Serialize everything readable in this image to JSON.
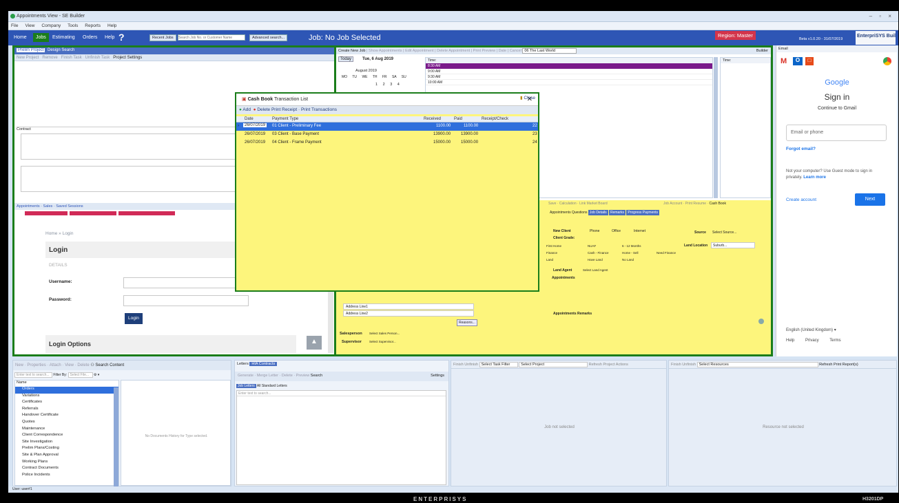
{
  "window": {
    "title": "Appointments View - SE Builder",
    "controls": "– ▫ ×"
  },
  "menu": [
    "File",
    "View",
    "Company",
    "Tools",
    "Reports",
    "Help"
  ],
  "nav": {
    "tabs": [
      "Home",
      "Jobs",
      "Estimating",
      "Orders",
      "Help"
    ],
    "help_icon": "?",
    "recent_jobs": "Recent Jobs",
    "search_placeholder": "Search Job No. or Customer Name",
    "advanced_search": "Advanced search...",
    "job_title": "Job: No Job Selected",
    "region": "Region: Master",
    "version": "Beta v1.0.20 - 31/07/2019",
    "logo": "EnterpriSYS Builder"
  },
  "left_top": {
    "tabs": [
      "Prelim Project",
      "Design Search"
    ],
    "toolbar": [
      "New Project",
      "Remove",
      "Finish Task",
      "Unfinish Task",
      "Project Settings"
    ],
    "contract_label": "Contract"
  },
  "calendar": {
    "tabs": [
      "Create New Job",
      "Show Appointments",
      "Edit Appointment",
      "Delete Appointment",
      "Print Preview",
      "Date",
      "Cancel",
      "06 The Last World",
      "Builder"
    ],
    "today": "Today",
    "date": "Tue, 6 Aug 2019",
    "month": "August 2019",
    "weekdays": [
      "MO",
      "TU",
      "WE",
      "TH",
      "FR",
      "SA",
      "SU"
    ],
    "days": [
      "1",
      "2",
      "3",
      "4"
    ],
    "time_header": "Time:",
    "times": [
      "8:30 AM",
      "9:00 AM",
      "9:30 AM",
      "10:00 AM"
    ]
  },
  "appointments": {
    "tabs": [
      "Appointments",
      "Sales",
      "Saved Sessions"
    ],
    "breadcrumb": [
      "Home",
      "Login"
    ],
    "login_title": "Login",
    "details": "DETAILS",
    "username_label": "Username:",
    "password_label": "Password:",
    "login_button": "Login",
    "login_options": "Login Options"
  },
  "dialog": {
    "title_bold": "Cash Book",
    "title_rest": "Transaction List",
    "close": "✕",
    "toolbar": {
      "add": "Add",
      "delete": "Delete",
      "print_receipt": "Print Receipt",
      "print_transactions": "Print Transactions",
      "close": "Close"
    },
    "columns": [
      "Date",
      "Payment Type",
      "Received",
      "Paid",
      "Receipt/Check"
    ],
    "rows": [
      {
        "date": "26/07/2019",
        "type": "01 Client - Preliminary Fee",
        "received": "1100.00",
        "paid": "1100.00",
        "receipt": "22"
      },
      {
        "date": "26/07/2019",
        "type": "03 Client - Base Payment",
        "received": "13900.00",
        "paid": "13900.00",
        "receipt": "23"
      },
      {
        "date": "26/07/2019",
        "type": "04 Client - Frame Payment",
        "received": "15000.00",
        "paid": "15000.00",
        "receipt": "24"
      }
    ]
  },
  "job_details": {
    "links": [
      "Save",
      "Calculation",
      "Link Market Board",
      "Job Account",
      "Print Resume",
      "Cash Book"
    ],
    "tabs": [
      "Appointments Questions",
      "Job Details",
      "Remarks",
      "Progress Payments"
    ],
    "new_client": "New Client",
    "phone": "Phone",
    "office": "Office",
    "internet": "Internet",
    "source_label": "Source",
    "source_value": "Select Source...",
    "client_grade": "Client Grade:",
    "grades": [
      "First Home",
      "NUAF",
      "6 - 12 Months",
      "Finance",
      "Cash - Finance",
      "Home - Sell",
      "Need Finance",
      "Land",
      "Have Land",
      "No Land"
    ],
    "land_location": "Land Location",
    "suburb": "Suburb...",
    "land_agent": "Land Agent",
    "land_agent_value": "Select Land Agent",
    "appointments": "Appointments",
    "appointments_remarks": "Appointments Remarks",
    "address1": "Address Line1",
    "address2": "Address Line2",
    "salesperson": "Salesperson",
    "salesperson_value": "Select Sales Person...",
    "supervisor": "Supervisor",
    "supervisor_value": "Select Supervisor...",
    "reasons": "Reasons..."
  },
  "email": {
    "header": "Email",
    "google": "Google",
    "sign_in": "Sign in",
    "continue": "Continue to Gmail",
    "email_placeholder": "Email or phone",
    "forgot": "Forgot email?",
    "guest_text": "Not your computer? Use Guest mode to sign in privately.",
    "learn_more": "Learn more",
    "create_account": "Create account",
    "next": "Next",
    "language": "English (United Kingdom)",
    "footer": [
      "Help",
      "Privacy",
      "Terms"
    ]
  },
  "docs": {
    "toolbar": [
      "New",
      "Properties",
      "Attach",
      "View",
      "Delete",
      "Search Content"
    ],
    "filter_placeholder": "Enter text to search...",
    "filter_by": "Filter By:",
    "filter_select": "Select File...",
    "tree_header": "Name",
    "tree": [
      "Orders",
      "Variations",
      "Certificates",
      "Referrals",
      "Handover Certificate",
      "Quotes",
      "Maintenance",
      "Client Correspondence",
      "Site Investigation",
      "Prelim Plans/Costing",
      "Site & Plan Approval",
      "Working Plans",
      "Contract Documents",
      "Police Incidents"
    ],
    "no_docs": "No Documents History for Type selected."
  },
  "letters": {
    "tabs": [
      "Letters",
      "HIA Contracts"
    ],
    "toolbar": [
      "Generate",
      "Merge Letter",
      "Delete",
      "Preview",
      "Search",
      "Settings"
    ],
    "subtabs": [
      "Job Letters",
      "All Standard Letters"
    ],
    "placeholder": "Enter text to search..."
  },
  "tasks": {
    "toolbar": [
      "Finish",
      "Unfinish",
      "Select Task Filter",
      "Select Project",
      "Refresh",
      "Project Actions"
    ],
    "empty": "Job not selected"
  },
  "resources": {
    "toolbar": [
      "Finish",
      "Unfinish",
      "Select Resources",
      "Refresh",
      "Print Report(s)"
    ],
    "empty": "Resource not selected"
  },
  "status": {
    "user": "User: user#1"
  },
  "footer": {
    "brand": "ENTERPRISYS",
    "model": "H3201DP"
  },
  "colors": {
    "accent_blue": "#2e56b5",
    "green_border": "#1a7d1a",
    "yellow": "#fdf57c",
    "selected_row": "#2f6fdc",
    "gmail_blue": "#1a73e8"
  }
}
